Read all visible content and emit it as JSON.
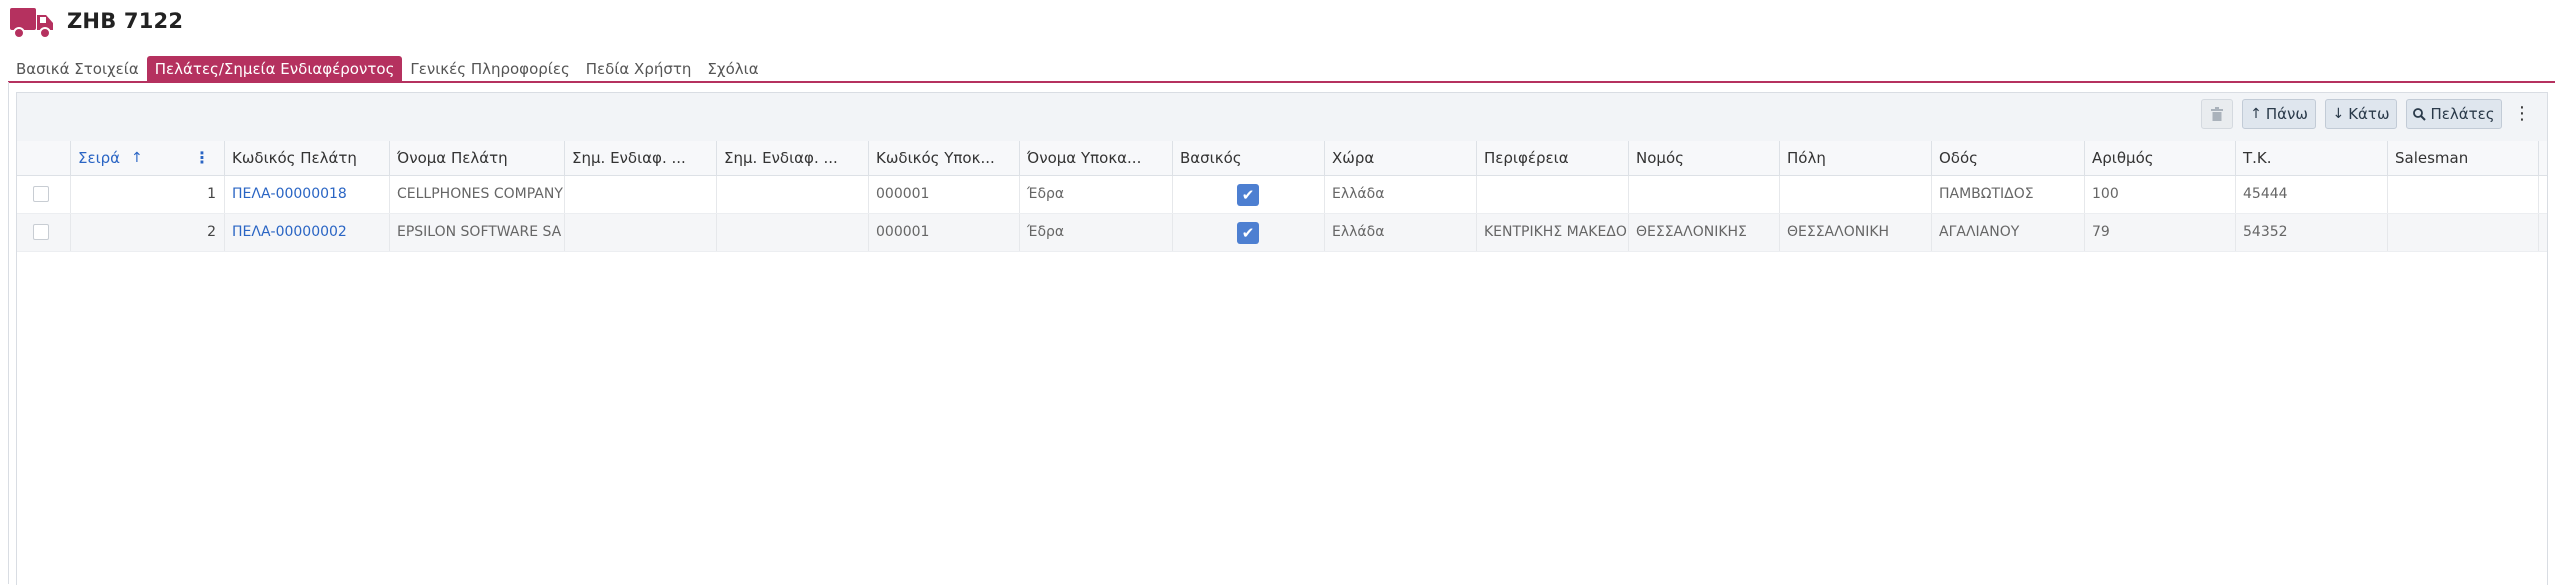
{
  "header": {
    "title": "ΖΗΒ 7122",
    "icon": "truck-icon",
    "icon_color": "#b5315f"
  },
  "tabs": [
    {
      "label": "Βασικά Στοιχεία",
      "active": false
    },
    {
      "label": "Πελάτες/Σημεία Ενδιαφέροντος",
      "active": true
    },
    {
      "label": "Γενικές Πληροφορίες",
      "active": false
    },
    {
      "label": "Πεδία Χρήστη",
      "active": false
    },
    {
      "label": "Σχόλια",
      "active": false
    }
  ],
  "toolbar": {
    "up_label": "Πάνω",
    "down_label": "Κάτω",
    "clients_label": "Πελάτες",
    "trash_icon": "trash-icon",
    "kebab_icon": "kebab-menu-icon"
  },
  "grid": {
    "columns": [
      "",
      "Σειρά",
      "Κωδικός Πελάτη",
      "Όνομα Πελάτη",
      "Σημ. Ενδιαφ. ...",
      "Σημ. Ενδιαφ. ...",
      "Κωδικός Υποκ...",
      "Όνομα Υποκα...",
      "Βασικός",
      "Χώρα",
      "Περιφέρεια",
      "Νομός",
      "Πόλη",
      "Οδός",
      "Αριθμός",
      "Τ.Κ.",
      "Salesman"
    ],
    "rows": [
      {
        "order": "1",
        "customer_code": "ΠΕΛΑ-00000018",
        "customer_name": "CELLPHONES COMPANY A",
        "poi1": "",
        "poi2": "",
        "branch_code": "000001",
        "branch_name": "Έδρα",
        "is_main": true,
        "country": "Ελλάδα",
        "region": "",
        "prefecture": "",
        "city": "",
        "street": "ΠΑΜΒΩΤΙΔΟΣ",
        "number": "100",
        "postal_code": "45444",
        "salesman": ""
      },
      {
        "order": "2",
        "customer_code": "ΠΕΛΑ-00000002",
        "customer_name": "EPSILON SOFTWARE SA",
        "poi1": "",
        "poi2": "",
        "branch_code": "000001",
        "branch_name": "Έδρα",
        "is_main": true,
        "country": "Ελλάδα",
        "region": "ΚΕΝΤΡΙΚΗΣ ΜΑΚΕΔΟΝ",
        "prefecture": "ΘΕΣΣΑΛΟΝΙΚΗΣ",
        "city": "ΘΕΣΣΑΛΟΝΙΚΗ",
        "street": "ΑΓΑΛΙΑΝΟΥ",
        "number": "79",
        "postal_code": "54352",
        "salesman": ""
      }
    ]
  }
}
